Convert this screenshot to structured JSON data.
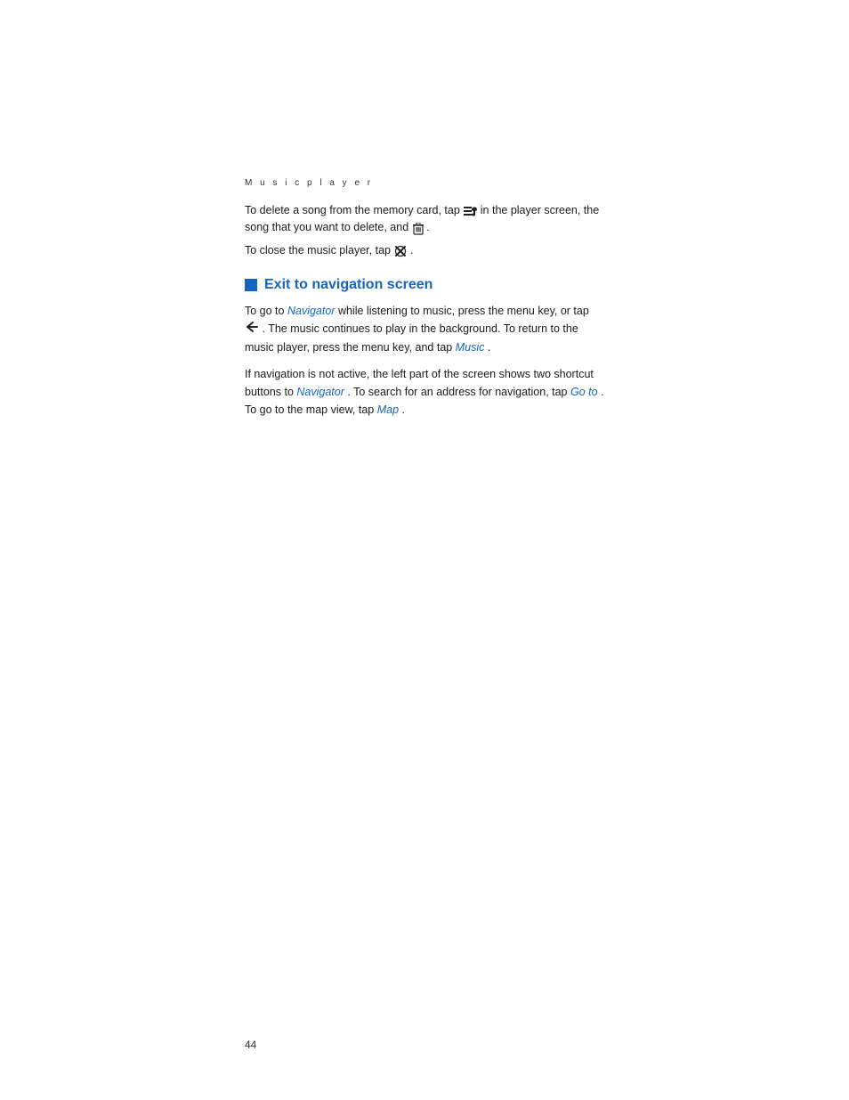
{
  "page": {
    "section_label": "M u s i c   p l a y e r",
    "delete_instruction": "To delete a song from the memory card, tap",
    "delete_instruction_mid": "in the player screen, the song that you want to delete, and",
    "close_instruction": "To close the music player, tap",
    "section_heading": "Exit to navigation screen",
    "paragraph1_start": "To go to",
    "paragraph1_link1": "Navigator",
    "paragraph1_mid": "while listening to music, press the menu key, or tap",
    "paragraph1_end": ". The music continues to play in the background. To return to the music player, press the menu key, and tap",
    "paragraph1_link2": "Music",
    "paragraph1_close": ".",
    "paragraph2_start": "If navigation is not active, the left part of the screen shows two shortcut buttons to",
    "paragraph2_link1": "Navigator",
    "paragraph2_mid": ". To search for an address for navigation, tap",
    "paragraph2_link2": "Go to",
    "paragraph2_end": ". To go to the map view, tap",
    "paragraph2_link3": "Map",
    "paragraph2_close": ".",
    "page_number": "44"
  }
}
